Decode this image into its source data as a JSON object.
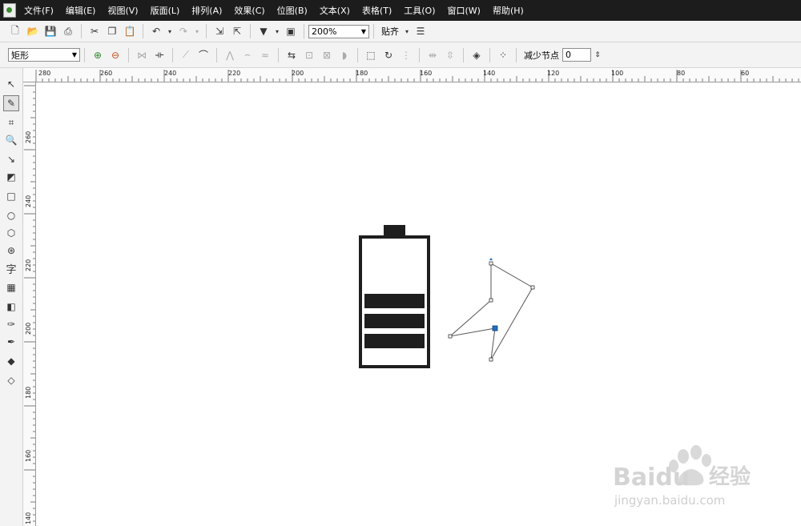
{
  "menu": [
    "文件(F)",
    "编辑(E)",
    "视图(V)",
    "版面(L)",
    "排列(A)",
    "效果(C)",
    "位图(B)",
    "文本(X)",
    "表格(T)",
    "工具(O)",
    "窗口(W)",
    "帮助(H)"
  ],
  "toolbar": {
    "zoom_value": "200%",
    "snap_label": "贴齐"
  },
  "property_bar": {
    "shape_type": "矩形",
    "reduce_nodes_label": "减少节点",
    "reduce_nodes_value": "0"
  },
  "ruler": {
    "h_labels": [
      "280",
      "260",
      "240",
      "220",
      "200",
      "180",
      "160",
      "140",
      "120",
      "100",
      "80",
      "60"
    ],
    "v_labels": [
      "260",
      "240",
      "220",
      "200",
      "180",
      "160",
      "140"
    ]
  },
  "toolbox": {
    "text_tool_glyph": "字"
  },
  "watermark": {
    "brand": "Baidu",
    "cn": "经验",
    "url": "jingyan.baidu.com"
  },
  "colors": {
    "menubar": "#1c1c1c",
    "battery": "#1e1e1e",
    "node_selected": "#1e6fc0"
  }
}
